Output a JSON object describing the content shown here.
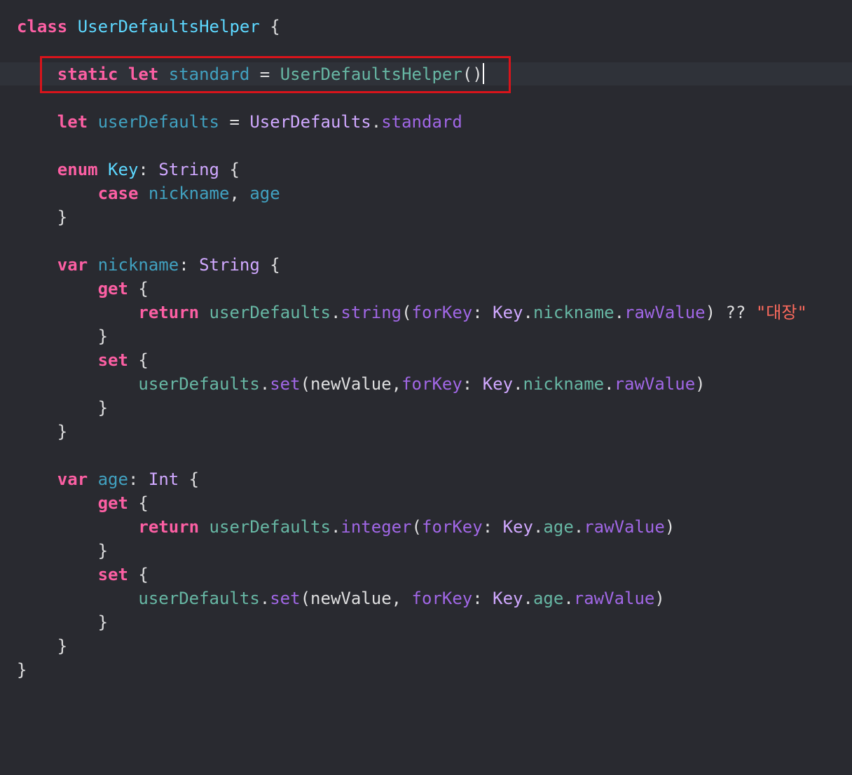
{
  "colors": {
    "background": "#292a30",
    "current_line": "#2f3239",
    "annotation_box": "#d8141b",
    "keyword": "#fc5fa3",
    "declaration": "#5dd8ff",
    "property": "#41a1c0",
    "type": "#d0a8ff",
    "project_member": "#a167e6",
    "project_call": "#67b7a4",
    "string": "#fc6a5d",
    "plain": "#dfdfe0"
  },
  "lines": [
    {
      "tokens": [
        {
          "t": "class",
          "c": "kw"
        },
        {
          "t": " "
        },
        {
          "t": "UserDefaultsHelper",
          "c": "decl"
        },
        {
          "t": " {"
        }
      ]
    },
    {
      "tokens": []
    },
    {
      "tokens": [
        {
          "t": "    "
        },
        {
          "t": "static",
          "c": "kw"
        },
        {
          "t": " "
        },
        {
          "t": "let",
          "c": "kw"
        },
        {
          "t": " "
        },
        {
          "t": "standard",
          "c": "prop"
        },
        {
          "t": " = "
        },
        {
          "t": "UserDefaultsHelper",
          "c": "call"
        },
        {
          "t": "()"
        }
      ],
      "cursor": true
    },
    {
      "tokens": []
    },
    {
      "tokens": [
        {
          "t": "    "
        },
        {
          "t": "let",
          "c": "kw"
        },
        {
          "t": " "
        },
        {
          "t": "userDefaults",
          "c": "prop"
        },
        {
          "t": " = "
        },
        {
          "t": "UserDefaults",
          "c": "type"
        },
        {
          "t": "."
        },
        {
          "t": "standard",
          "c": "ptype"
        }
      ]
    },
    {
      "tokens": []
    },
    {
      "tokens": [
        {
          "t": "    "
        },
        {
          "t": "enum",
          "c": "kw"
        },
        {
          "t": " "
        },
        {
          "t": "Key",
          "c": "decl"
        },
        {
          "t": ": "
        },
        {
          "t": "String",
          "c": "type"
        },
        {
          "t": " {"
        }
      ]
    },
    {
      "tokens": [
        {
          "t": "        "
        },
        {
          "t": "case",
          "c": "kw"
        },
        {
          "t": " "
        },
        {
          "t": "nickname",
          "c": "prop"
        },
        {
          "t": ", "
        },
        {
          "t": "age",
          "c": "prop"
        }
      ]
    },
    {
      "tokens": [
        {
          "t": "    }"
        }
      ]
    },
    {
      "tokens": []
    },
    {
      "tokens": [
        {
          "t": "    "
        },
        {
          "t": "var",
          "c": "kw"
        },
        {
          "t": " "
        },
        {
          "t": "nickname",
          "c": "prop"
        },
        {
          "t": ": "
        },
        {
          "t": "String",
          "c": "type"
        },
        {
          "t": " {"
        }
      ]
    },
    {
      "tokens": [
        {
          "t": "        "
        },
        {
          "t": "get",
          "c": "kw"
        },
        {
          "t": " {"
        }
      ]
    },
    {
      "tokens": [
        {
          "t": "            "
        },
        {
          "t": "return",
          "c": "kw"
        },
        {
          "t": " "
        },
        {
          "t": "userDefaults",
          "c": "call"
        },
        {
          "t": "."
        },
        {
          "t": "string",
          "c": "ptype"
        },
        {
          "t": "("
        },
        {
          "t": "forKey",
          "c": "ptype"
        },
        {
          "t": ": "
        },
        {
          "t": "Key",
          "c": "type"
        },
        {
          "t": "."
        },
        {
          "t": "nickname",
          "c": "call"
        },
        {
          "t": "."
        },
        {
          "t": "rawValue",
          "c": "ptype"
        },
        {
          "t": ") ?? "
        },
        {
          "t": "\"대장\"",
          "c": "str"
        }
      ]
    },
    {
      "tokens": [
        {
          "t": "        }"
        }
      ]
    },
    {
      "tokens": [
        {
          "t": "        "
        },
        {
          "t": "set",
          "c": "kw"
        },
        {
          "t": " {"
        }
      ]
    },
    {
      "tokens": [
        {
          "t": "            "
        },
        {
          "t": "userDefaults",
          "c": "call"
        },
        {
          "t": "."
        },
        {
          "t": "set",
          "c": "ptype"
        },
        {
          "t": "(newValue,"
        },
        {
          "t": "forKey",
          "c": "ptype"
        },
        {
          "t": ": "
        },
        {
          "t": "Key",
          "c": "type"
        },
        {
          "t": "."
        },
        {
          "t": "nickname",
          "c": "call"
        },
        {
          "t": "."
        },
        {
          "t": "rawValue",
          "c": "ptype"
        },
        {
          "t": ")"
        }
      ]
    },
    {
      "tokens": [
        {
          "t": "        }"
        }
      ]
    },
    {
      "tokens": [
        {
          "t": "    }"
        }
      ]
    },
    {
      "tokens": []
    },
    {
      "tokens": [
        {
          "t": "    "
        },
        {
          "t": "var",
          "c": "kw"
        },
        {
          "t": " "
        },
        {
          "t": "age",
          "c": "prop"
        },
        {
          "t": ": "
        },
        {
          "t": "Int",
          "c": "type"
        },
        {
          "t": " {"
        }
      ]
    },
    {
      "tokens": [
        {
          "t": "        "
        },
        {
          "t": "get",
          "c": "kw"
        },
        {
          "t": " {"
        }
      ]
    },
    {
      "tokens": [
        {
          "t": "            "
        },
        {
          "t": "return",
          "c": "kw"
        },
        {
          "t": " "
        },
        {
          "t": "userDefaults",
          "c": "call"
        },
        {
          "t": "."
        },
        {
          "t": "integer",
          "c": "ptype"
        },
        {
          "t": "("
        },
        {
          "t": "forKey",
          "c": "ptype"
        },
        {
          "t": ": "
        },
        {
          "t": "Key",
          "c": "type"
        },
        {
          "t": "."
        },
        {
          "t": "age",
          "c": "call"
        },
        {
          "t": "."
        },
        {
          "t": "rawValue",
          "c": "ptype"
        },
        {
          "t": ")"
        }
      ]
    },
    {
      "tokens": [
        {
          "t": "        }"
        }
      ]
    },
    {
      "tokens": [
        {
          "t": "        "
        },
        {
          "t": "set",
          "c": "kw"
        },
        {
          "t": " {"
        }
      ]
    },
    {
      "tokens": [
        {
          "t": "            "
        },
        {
          "t": "userDefaults",
          "c": "call"
        },
        {
          "t": "."
        },
        {
          "t": "set",
          "c": "ptype"
        },
        {
          "t": "(newValue, "
        },
        {
          "t": "forKey",
          "c": "ptype"
        },
        {
          "t": ": "
        },
        {
          "t": "Key",
          "c": "type"
        },
        {
          "t": "."
        },
        {
          "t": "age",
          "c": "call"
        },
        {
          "t": "."
        },
        {
          "t": "rawValue",
          "c": "ptype"
        },
        {
          "t": ")"
        }
      ]
    },
    {
      "tokens": [
        {
          "t": "        }"
        }
      ]
    },
    {
      "tokens": [
        {
          "t": "    }"
        }
      ]
    },
    {
      "tokens": [
        {
          "t": "}"
        }
      ]
    }
  ]
}
